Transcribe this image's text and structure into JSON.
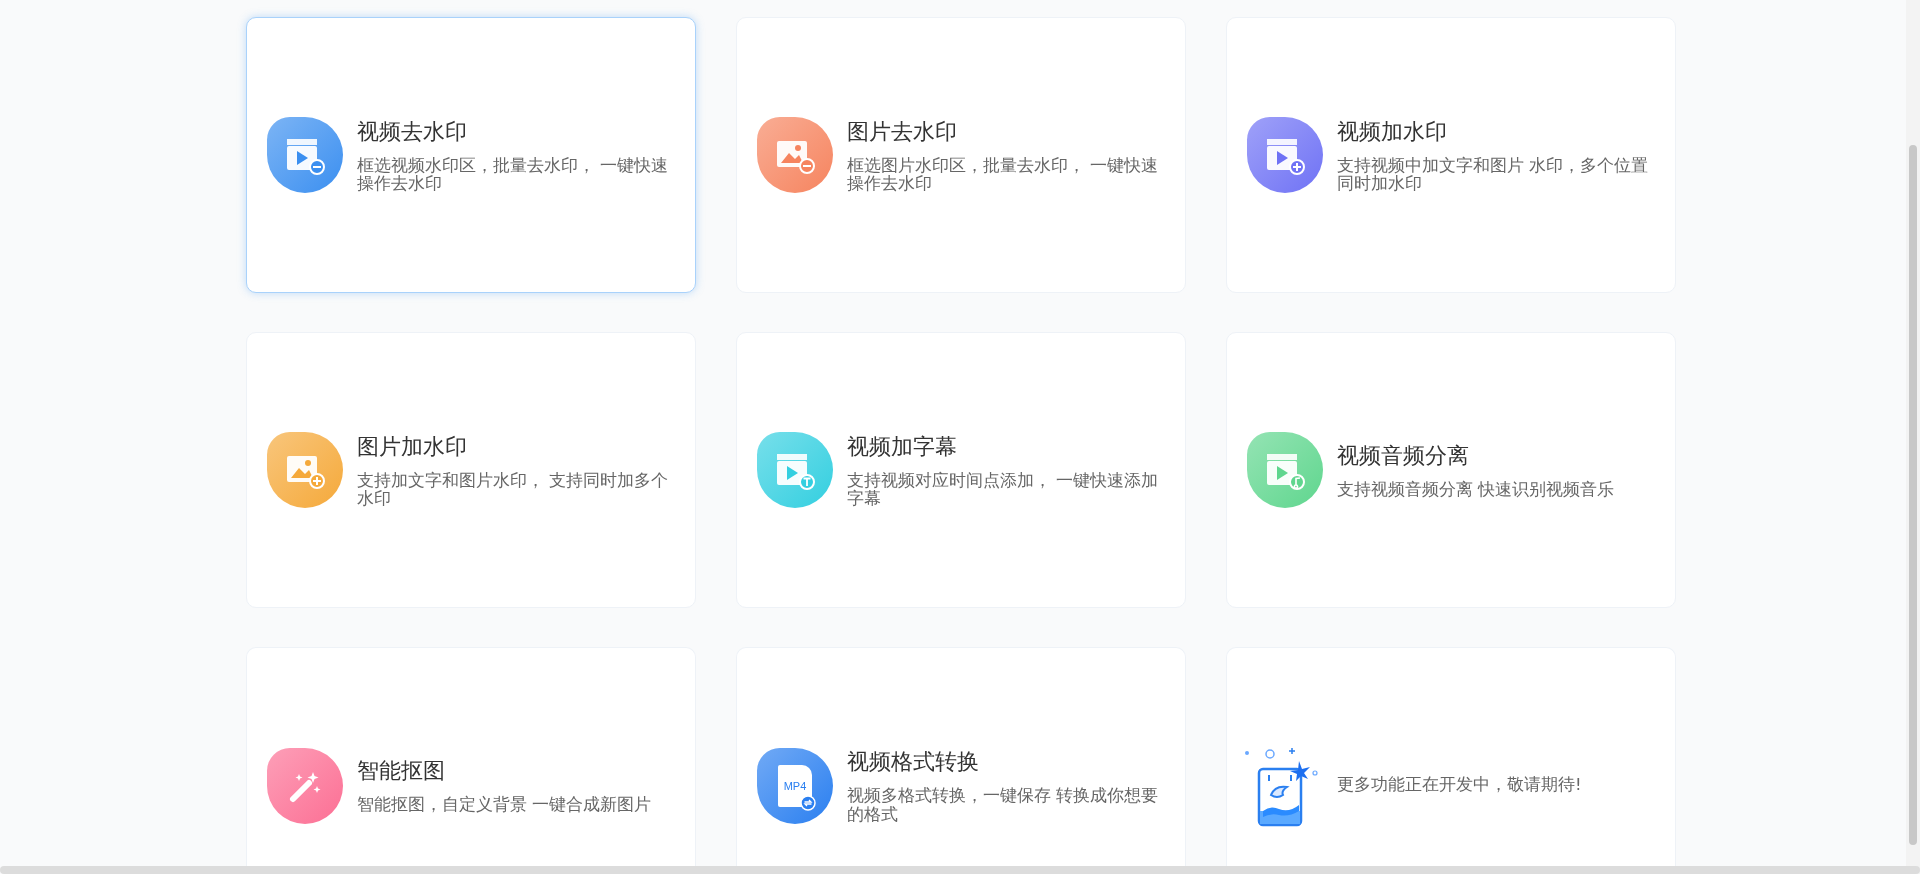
{
  "cards": [
    {
      "kind": "feature",
      "highlighted": true,
      "title": "视频去水印",
      "description": "框选视频水印区，批量去水印， 一键快速操作去水印"
    },
    {
      "kind": "feature",
      "highlighted": false,
      "title": "图片去水印",
      "description": "框选图片水印区，批量去水印， 一键快速操作去水印"
    },
    {
      "kind": "feature",
      "highlighted": false,
      "title": "视频加水印",
      "description": "支持视频中加文字和图片 水印，多个位置同时加水印"
    },
    {
      "kind": "feature",
      "highlighted": false,
      "title": "图片加水印",
      "description": "支持加文字和图片水印， 支持同时加多个水印"
    },
    {
      "kind": "feature",
      "highlighted": false,
      "title": "视频加字幕",
      "description": "支持视频对应时间点添加， 一键快速添加字幕"
    },
    {
      "kind": "feature",
      "highlighted": false,
      "title": "视频音频分离",
      "description": "支持视频音频分离 快速识别视频音乐"
    },
    {
      "kind": "feature",
      "highlighted": false,
      "title": "智能抠图",
      "description": "智能抠图，自定义背景 一键合成新图片"
    },
    {
      "kind": "feature",
      "highlighted": false,
      "title": "视频格式转换",
      "description": "视频多格式转换，一键保存 转换成你想要的格式",
      "icon_label": "MP4"
    },
    {
      "kind": "placeholder",
      "highlighted": false,
      "description": "更多功能正在开发中，敬请期待!"
    }
  ]
}
